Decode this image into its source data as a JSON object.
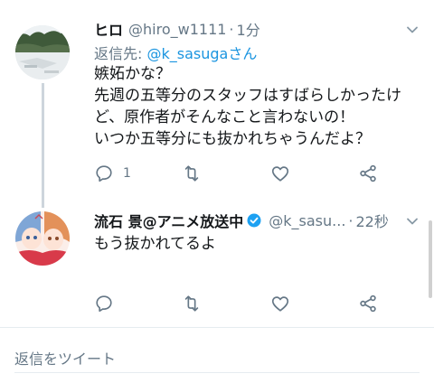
{
  "tweets": [
    {
      "name": "ヒロ",
      "handle": "@hiro_w1111",
      "separator": "·",
      "time": "1分",
      "replying_prefix": "返信先: ",
      "replying_mention": "@k_sasugaさん",
      "lines": [
        "嫉妬かな？",
        "先週の五等分のスタッフはすばらしかったけ",
        "ど、原作者がそんなこと言わないの！",
        "いつか五等分にも抜かれちゃうんだよ？"
      ],
      "reply_count": "1",
      "avatar": "landscape-photo"
    },
    {
      "name": "流石 景@アニメ放送中",
      "verified": true,
      "handle": "@k_sasu...",
      "separator": "·",
      "time": "22秒",
      "lines": [
        "もう抜かれてるよ"
      ],
      "avatar": "anime-girls-illustration"
    }
  ],
  "icons": {
    "reply": "reply-icon",
    "retweet": "retweet-icon",
    "like": "heart-icon",
    "share": "share-icon",
    "more": "chevron-down-icon",
    "verified": "verified-badge-icon"
  },
  "compose": {
    "placeholder": "返信をツイート"
  },
  "colors": {
    "text": "#14171a",
    "secondary": "#657786",
    "mention": "#1b95e0",
    "verified": "#1da1f2",
    "divider": "#e6ecf0",
    "thread_line": "#cdd5dc"
  }
}
